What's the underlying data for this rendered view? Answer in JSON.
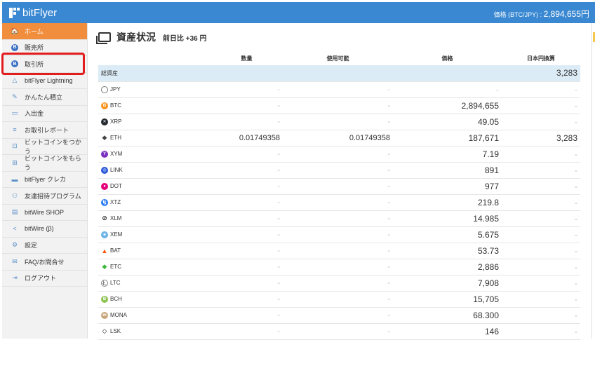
{
  "header": {
    "logo_text": "bitFlyer",
    "price_label": "価格 (BTC/JPY) : ",
    "price_value": "2,894,655円"
  },
  "sidebar": {
    "items": [
      {
        "label": "ホーム",
        "icon": "home-icon",
        "glyph": "🏠"
      },
      {
        "label": "販売所",
        "icon": "bitcoin-icon",
        "glyph": "B"
      },
      {
        "label": "取引所",
        "icon": "bitcoin-icon",
        "glyph": "B"
      },
      {
        "label": "bitFlyer Lightning",
        "icon": "lightning-icon",
        "glyph": "△"
      },
      {
        "label": "かんたん積立",
        "icon": "savings-icon",
        "glyph": "✎"
      },
      {
        "label": "入出金",
        "icon": "wallet-icon",
        "glyph": "▭"
      },
      {
        "label": "お取引レポート",
        "icon": "report-icon",
        "glyph": "≡"
      },
      {
        "label": "ビットコインをつかう",
        "icon": "cart-icon",
        "glyph": "⊡"
      },
      {
        "label": "ビットコインをもらう",
        "icon": "gift-icon",
        "glyph": "⊞"
      },
      {
        "label": "bitFlyer クレカ",
        "icon": "card-icon",
        "glyph": "▬"
      },
      {
        "label": "友達招待プログラム",
        "icon": "people-icon",
        "glyph": "⚇"
      },
      {
        "label": "bitWire SHOP",
        "icon": "shop-icon",
        "glyph": "▤"
      },
      {
        "label": "bitWire (β)",
        "icon": "share-icon",
        "glyph": "<"
      },
      {
        "label": "設定",
        "icon": "gear-icon",
        "glyph": "⚙"
      },
      {
        "label": "FAQ/お問合せ",
        "icon": "mail-icon",
        "glyph": "✉"
      },
      {
        "label": "ログアウト",
        "icon": "logout-icon",
        "glyph": "⇥"
      }
    ]
  },
  "main": {
    "title": "資産状況",
    "subtitle": "前日比 +36 円",
    "columns": [
      "数量",
      "使用可能",
      "価格",
      "日本円換算"
    ],
    "total": {
      "label": "総資産",
      "value": "3,283"
    },
    "rows": [
      {
        "name": "JPY",
        "color": "#ffffff",
        "border": "#777",
        "glyph": "¥",
        "qty": "-",
        "avail": "-",
        "price": "-",
        "jpy": "-"
      },
      {
        "name": "BTC",
        "color": "#f7931a",
        "glyph": "B",
        "qty": "-",
        "avail": "-",
        "price": "2,894,655",
        "jpy": "-"
      },
      {
        "name": "XRP",
        "color": "#23292f",
        "glyph": "✕",
        "qty": "-",
        "avail": "-",
        "price": "49.05",
        "jpy": "-"
      },
      {
        "name": "ETH",
        "color": "#ffffff",
        "border": "#fff",
        "glyph": "◆",
        "textcolor": "#444",
        "qty": "0.01749358",
        "avail": "0.01749358",
        "price": "187,671",
        "jpy": "3,283"
      },
      {
        "name": "XYM",
        "color": "#7b2fbe",
        "glyph": "Y",
        "qty": "-",
        "avail": "-",
        "price": "7.19",
        "jpy": "-"
      },
      {
        "name": "LINK",
        "color": "#2a5ada",
        "glyph": "◎",
        "qty": "-",
        "avail": "-",
        "price": "891",
        "jpy": "-"
      },
      {
        "name": "DOT",
        "color": "#e6007a",
        "glyph": "●",
        "qty": "-",
        "avail": "-",
        "price": "977",
        "jpy": "-"
      },
      {
        "name": "XTZ",
        "color": "#2c7df7",
        "glyph": "ꜩ",
        "qty": "-",
        "avail": "-",
        "price": "219.8",
        "jpy": "-"
      },
      {
        "name": "XLM",
        "color": "#ffffff",
        "border": "#fff",
        "glyph": "⊘",
        "textcolor": "#222",
        "qty": "-",
        "avail": "-",
        "price": "14.985",
        "jpy": "-"
      },
      {
        "name": "XEM",
        "color": "#67b2e8",
        "glyph": "◈",
        "qty": "-",
        "avail": "-",
        "price": "5.675",
        "jpy": "-"
      },
      {
        "name": "BAT",
        "color": "#ffffff",
        "border": "#fff",
        "glyph": "▲",
        "textcolor": "#ff5000",
        "qty": "-",
        "avail": "-",
        "price": "53.73",
        "jpy": "-"
      },
      {
        "name": "ETC",
        "color": "#ffffff",
        "border": "#fff",
        "glyph": "◆",
        "textcolor": "#3ab83a",
        "qty": "-",
        "avail": "-",
        "price": "2,886",
        "jpy": "-"
      },
      {
        "name": "LTC",
        "color": "#ffffff",
        "border": "#888",
        "glyph": "Ł",
        "textcolor": "#888",
        "qty": "-",
        "avail": "-",
        "price": "7,908",
        "jpy": "-"
      },
      {
        "name": "BCH",
        "color": "#8dc351",
        "glyph": "B",
        "qty": "-",
        "avail": "-",
        "price": "15,705",
        "jpy": "-"
      },
      {
        "name": "MONA",
        "color": "#c9a77c",
        "glyph": "m",
        "qty": "-",
        "avail": "-",
        "price": "68.300",
        "jpy": "-"
      },
      {
        "name": "LSK",
        "color": "#ffffff",
        "border": "#fff",
        "glyph": "◇",
        "textcolor": "#111",
        "qty": "-",
        "avail": "-",
        "price": "146",
        "jpy": "-"
      }
    ]
  }
}
